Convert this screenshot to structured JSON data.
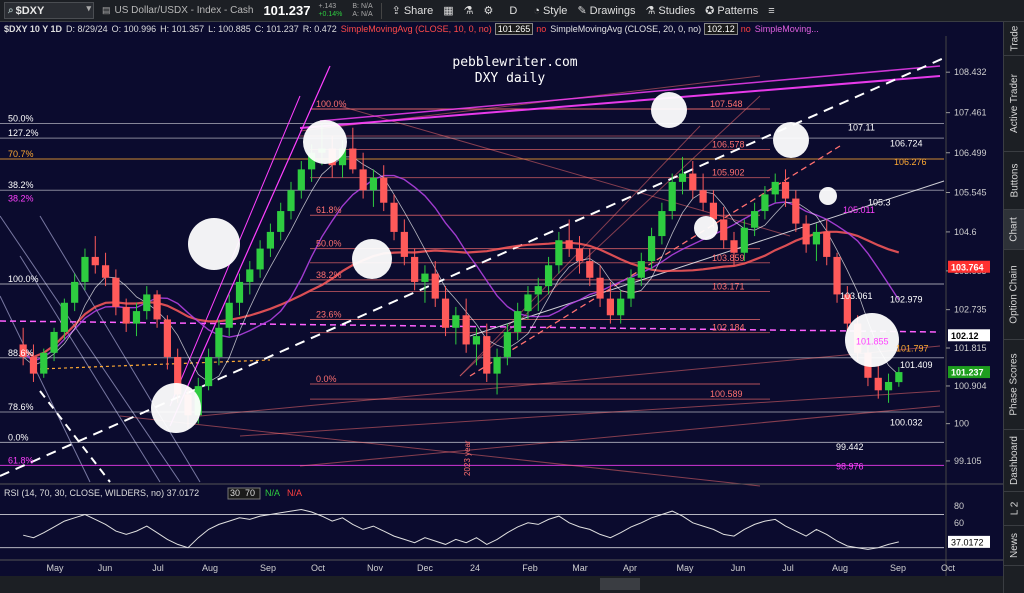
{
  "toolbar": {
    "symbol": "$DXY",
    "description": "US Dollar/USDX - Index - Cash",
    "last": "101.237",
    "change": "+.143",
    "change_pct": "+0.14%",
    "bid": "B: N/A",
    "ask": "A: N/A",
    "share_label": "Share",
    "period_label": "D",
    "style_label": "Style",
    "drawings_label": "Drawings",
    "studies_label": "Studies",
    "patterns_label": "Patterns"
  },
  "subheader": {
    "title": "$DXY 10 Y 1D",
    "date": "D: 8/29/24",
    "open": "O: 100.996",
    "high": "H: 101.357",
    "low": "L: 100.885",
    "close": "C: 101.237",
    "range": "R: 0.472",
    "sma1_label": "SimpleMovingAvg (CLOSE, 10, 0, no)",
    "sma1_value": "101.265",
    "sma1_flag": "no",
    "sma2_label": "SimpleMovingAvg (CLOSE, 20, 0, no)",
    "sma2_value": "102.12",
    "sma2_flag": "no",
    "sma3_label": "SimpleMoving..."
  },
  "side_tabs": [
    "Trade",
    "Active Trader",
    "Buttons",
    "Chart",
    "Option Chain",
    "Phase Scores",
    "Dashboard",
    "L 2",
    "News"
  ],
  "colors": {
    "background": "#0b0b2e",
    "sma_red": "#ff5a5a",
    "sma_purple": "#b040e0",
    "fib_red": "#ff7070",
    "magenta": "#ff40ff",
    "white_line": "#ffffff",
    "price_up": "#2ecc40",
    "price_down": "#ff5a5a",
    "last_badge": "#1e9e1e",
    "sma20_badge": "#ffffff",
    "sma10_badge": "#ff3030"
  },
  "chart_data": {
    "type": "candlestick",
    "title": "pebblewriter.com",
    "subtitle": "DXY daily",
    "annotation": "2023 year",
    "x_ticks": [
      "May",
      "Jun",
      "Jul",
      "Aug",
      "Sep",
      "Oct",
      "Nov",
      "Dec",
      "24",
      "Feb",
      "Mar",
      "Apr",
      "May",
      "Jun",
      "Jul",
      "Aug",
      "Sep",
      "Oct"
    ],
    "y_ticks": [
      "108.432",
      "107.461",
      "106.499",
      "105.545",
      "104.6",
      "103.665",
      "102.735",
      "101.815",
      "100.904",
      "100",
      "99.105"
    ],
    "ylim": [
      98.6,
      109.3
    ],
    "price_badges": [
      {
        "label": "103.764",
        "value": 103.764,
        "color": "#ff3030"
      },
      {
        "label": "102.12",
        "value": 102.12,
        "color": "#ffffff"
      },
      {
        "label": "101.237",
        "value": 101.237,
        "color": "#1e9e1e"
      }
    ],
    "fib_left": [
      {
        "label": "100.0%",
        "value": 107.55,
        "color": "#ff7070"
      },
      {
        "label": "61.8%",
        "value": 105.0,
        "color": "#ff7070"
      },
      {
        "label": "50.0%",
        "value": 104.2,
        "color": "#ff7070"
      },
      {
        "label": "38.2%",
        "value": 103.45,
        "color": "#ff7070"
      },
      {
        "label": "23.6%",
        "value": 102.5,
        "color": "#ff7070"
      },
      {
        "label": "0.0%",
        "value": 100.95,
        "color": "#ff7070"
      }
    ],
    "fib_far_left": [
      {
        "label": "50.0%",
        "value": 107.2,
        "color": "#ffffff"
      },
      {
        "label": "127.2%",
        "value": 106.85,
        "color": "#ffffff"
      },
      {
        "label": "70.7%",
        "value": 106.35,
        "color": "#ffaa33"
      },
      {
        "label": "38.2%",
        "value": 105.6,
        "color": "#ffffff"
      },
      {
        "label": "38.2%",
        "value": 105.28,
        "color": "#ff40ff"
      },
      {
        "label": "100.0%",
        "value": 103.35,
        "color": "#ffffff"
      },
      {
        "label": "88.6%",
        "value": 101.58,
        "color": "#ffffff"
      },
      {
        "label": "78.6%",
        "value": 100.28,
        "color": "#ffffff"
      },
      {
        "label": "0.0%",
        "value": 99.55,
        "color": "#ffffff"
      },
      {
        "label": "61.8%",
        "value": 99.0,
        "color": "#ff40ff"
      }
    ],
    "level_labels": [
      {
        "label": "107.548",
        "value": 107.548,
        "color": "#ff7070"
      },
      {
        "label": "106.578",
        "value": 106.578,
        "color": "#ff7070"
      },
      {
        "label": "105.902",
        "value": 105.902,
        "color": "#ff7070"
      },
      {
        "label": "105.011",
        "value": 105.011,
        "color": "#ff40ff"
      },
      {
        "label": "103.859",
        "value": 103.859,
        "color": "#ff7070"
      },
      {
        "label": "103.171",
        "value": 103.171,
        "color": "#ff7070"
      },
      {
        "label": "102.184",
        "value": 102.184,
        "color": "#ff7070"
      },
      {
        "label": "101.855",
        "value": 101.855,
        "color": "#ff40ff"
      },
      {
        "label": "100.589",
        "value": 100.589,
        "color": "#ff7070"
      }
    ],
    "right_labels": [
      {
        "label": "107.11",
        "value": 107.11,
        "color": "#ffffff"
      },
      {
        "label": "106.724",
        "value": 106.724,
        "color": "#ffffff"
      },
      {
        "label": "106.276",
        "value": 106.276,
        "color": "#ffaa33"
      },
      {
        "label": "105.3",
        "value": 105.3,
        "color": "#ffffff"
      },
      {
        "label": "103.061",
        "value": 103.061,
        "color": "#ffffff"
      },
      {
        "label": "102.979",
        "value": 102.979,
        "color": "#ffffff"
      },
      {
        "label": "101.797",
        "value": 101.797,
        "color": "#ffaa33"
      },
      {
        "label": "101.409",
        "value": 101.409,
        "color": "#ffffff"
      },
      {
        "label": "100.032",
        "value": 100.032,
        "color": "#ffffff"
      },
      {
        "label": "99.442",
        "value": 99.442,
        "color": "#ffffff"
      },
      {
        "label": "98.976",
        "value": 98.976,
        "color": "#ff40ff"
      }
    ],
    "candles": [
      [
        0,
        101.9,
        102.3,
        101.4,
        101.6
      ],
      [
        1,
        101.6,
        101.9,
        101.0,
        101.2
      ],
      [
        2,
        101.2,
        101.8,
        101.1,
        101.7
      ],
      [
        3,
        101.7,
        102.3,
        101.5,
        102.2
      ],
      [
        4,
        102.2,
        103.0,
        102.0,
        102.9
      ],
      [
        5,
        102.9,
        103.6,
        102.7,
        103.4
      ],
      [
        6,
        103.4,
        104.2,
        103.2,
        104.0
      ],
      [
        7,
        104.0,
        104.5,
        103.6,
        103.8
      ],
      [
        8,
        103.8,
        104.1,
        103.3,
        103.5
      ],
      [
        9,
        103.5,
        103.7,
        102.6,
        102.8
      ],
      [
        10,
        102.8,
        103.0,
        102.2,
        102.4
      ],
      [
        11,
        102.4,
        102.9,
        102.1,
        102.7
      ],
      [
        12,
        102.7,
        103.3,
        102.5,
        103.1
      ],
      [
        13,
        103.1,
        103.2,
        102.3,
        102.5
      ],
      [
        14,
        102.5,
        102.6,
        101.3,
        101.6
      ],
      [
        15,
        101.6,
        101.8,
        100.5,
        100.7
      ],
      [
        16,
        100.7,
        100.9,
        99.9,
        100.2
      ],
      [
        17,
        100.2,
        101.1,
        100.0,
        100.9
      ],
      [
        18,
        100.9,
        101.8,
        100.8,
        101.6
      ],
      [
        19,
        101.6,
        102.5,
        101.4,
        102.3
      ],
      [
        20,
        102.3,
        103.1,
        102.1,
        102.9
      ],
      [
        21,
        102.9,
        103.6,
        102.6,
        103.4
      ],
      [
        22,
        103.4,
        103.9,
        103.1,
        103.7
      ],
      [
        23,
        103.7,
        104.4,
        103.5,
        104.2
      ],
      [
        24,
        104.2,
        104.8,
        104.0,
        104.6
      ],
      [
        25,
        104.6,
        105.3,
        104.4,
        105.1
      ],
      [
        26,
        105.1,
        105.8,
        104.9,
        105.6
      ],
      [
        27,
        105.6,
        106.3,
        105.4,
        106.1
      ],
      [
        28,
        106.1,
        106.7,
        105.8,
        106.5
      ],
      [
        29,
        106.5,
        107.2,
        106.2,
        106.6
      ],
      [
        30,
        106.6,
        106.9,
        105.9,
        106.2
      ],
      [
        31,
        106.2,
        106.8,
        105.9,
        106.6
      ],
      [
        32,
        106.6,
        107.1,
        106.0,
        106.1
      ],
      [
        33,
        106.1,
        106.5,
        105.4,
        105.6
      ],
      [
        34,
        105.6,
        106.1,
        105.2,
        105.9
      ],
      [
        35,
        105.9,
        106.2,
        105.1,
        105.3
      ],
      [
        36,
        105.3,
        105.5,
        104.4,
        104.6
      ],
      [
        37,
        104.6,
        104.9,
        103.8,
        104.0
      ],
      [
        38,
        104.0,
        104.2,
        103.2,
        103.4
      ],
      [
        39,
        103.4,
        103.8,
        102.9,
        103.6
      ],
      [
        40,
        103.6,
        103.9,
        102.8,
        103.0
      ],
      [
        41,
        103.0,
        103.3,
        102.1,
        102.3
      ],
      [
        42,
        102.3,
        102.8,
        101.9,
        102.6
      ],
      [
        43,
        102.6,
        103.0,
        101.7,
        101.9
      ],
      [
        44,
        101.9,
        102.3,
        101.4,
        102.1
      ],
      [
        45,
        102.1,
        102.4,
        101.0,
        101.2
      ],
      [
        46,
        101.2,
        101.8,
        100.7,
        101.6
      ],
      [
        47,
        101.6,
        102.4,
        101.4,
        102.2
      ],
      [
        48,
        102.2,
        102.9,
        102.0,
        102.7
      ],
      [
        49,
        102.7,
        103.3,
        102.5,
        103.1
      ],
      [
        50,
        103.1,
        103.5,
        102.7,
        103.3
      ],
      [
        51,
        103.3,
        104.0,
        103.1,
        103.8
      ],
      [
        52,
        103.8,
        104.6,
        103.6,
        104.4
      ],
      [
        53,
        104.4,
        104.9,
        104.0,
        104.2
      ],
      [
        54,
        104.2,
        104.5,
        103.6,
        103.9
      ],
      [
        55,
        103.9,
        104.2,
        103.3,
        103.5
      ],
      [
        56,
        103.5,
        103.8,
        102.8,
        103.0
      ],
      [
        57,
        103.0,
        103.4,
        102.4,
        102.6
      ],
      [
        58,
        102.6,
        103.2,
        102.4,
        103.0
      ],
      [
        59,
        103.0,
        103.7,
        102.8,
        103.5
      ],
      [
        60,
        103.5,
        104.1,
        103.3,
        103.9
      ],
      [
        61,
        103.9,
        104.7,
        103.7,
        104.5
      ],
      [
        62,
        104.5,
        105.3,
        104.3,
        105.1
      ],
      [
        63,
        105.1,
        106.0,
        104.9,
        105.8
      ],
      [
        64,
        105.8,
        106.4,
        105.5,
        106.0
      ],
      [
        65,
        106.0,
        106.3,
        105.4,
        105.6
      ],
      [
        66,
        105.6,
        106.0,
        105.1,
        105.3
      ],
      [
        67,
        105.3,
        105.6,
        104.7,
        104.9
      ],
      [
        68,
        104.9,
        105.2,
        104.2,
        104.4
      ],
      [
        69,
        104.4,
        104.6,
        103.8,
        104.1
      ],
      [
        70,
        104.1,
        104.9,
        103.9,
        104.7
      ],
      [
        71,
        104.7,
        105.3,
        104.5,
        105.1
      ],
      [
        72,
        105.1,
        105.7,
        104.9,
        105.5
      ],
      [
        73,
        105.5,
        106.0,
        105.3,
        105.8
      ],
      [
        74,
        105.8,
        106.1,
        105.2,
        105.4
      ],
      [
        75,
        105.4,
        105.6,
        104.6,
        104.8
      ],
      [
        76,
        104.8,
        105.0,
        104.1,
        104.3
      ],
      [
        77,
        104.3,
        104.8,
        103.9,
        104.6
      ],
      [
        78,
        104.6,
        104.9,
        103.8,
        104.0
      ],
      [
        79,
        104.0,
        104.1,
        102.9,
        103.1
      ],
      [
        80,
        103.1,
        103.3,
        102.2,
        102.4
      ],
      [
        81,
        102.4,
        102.6,
        101.5,
        101.7
      ],
      [
        82,
        101.7,
        102.0,
        100.9,
        101.1
      ],
      [
        83,
        101.1,
        101.4,
        100.6,
        100.8
      ],
      [
        84,
        100.8,
        101.2,
        100.5,
        101.0
      ],
      [
        85,
        100.996,
        101.357,
        100.885,
        101.237
      ]
    ],
    "series": [
      {
        "name": "SimpleMovingAvg (CLOSE, 10, 0, no)",
        "last": 101.265
      },
      {
        "name": "SimpleMovingAvg (CLOSE, 20, 0, no)",
        "last": 102.12
      }
    ],
    "rsi": {
      "label": "RSI (14, 70, 30, CLOSE, WILDERS, no)",
      "value": "37.0172",
      "overbought": "70",
      "oversold": "30",
      "flag1": "N/A",
      "flag2": "N/A",
      "y_ticks": [
        "80",
        "60",
        "40"
      ],
      "ylim": [
        20,
        85
      ],
      "values": [
        45,
        42,
        48,
        55,
        62,
        66,
        70,
        64,
        58,
        50,
        46,
        50,
        56,
        48,
        40,
        34,
        30,
        42,
        52,
        58,
        62,
        66,
        64,
        68,
        70,
        72,
        74,
        76,
        73,
        68,
        62,
        66,
        58,
        52,
        56,
        50,
        44,
        40,
        36,
        42,
        38,
        34,
        40,
        36,
        42,
        34,
        40,
        48,
        55,
        60,
        58,
        64,
        68,
        60,
        55,
        52,
        46,
        42,
        48,
        55,
        60,
        66,
        70,
        74,
        68,
        60,
        56,
        52,
        46,
        44,
        52,
        58,
        62,
        64,
        56,
        50,
        44,
        52,
        46,
        38,
        32,
        30,
        28,
        30,
        34,
        37
      ]
    },
    "grid": false,
    "legend": "none"
  }
}
